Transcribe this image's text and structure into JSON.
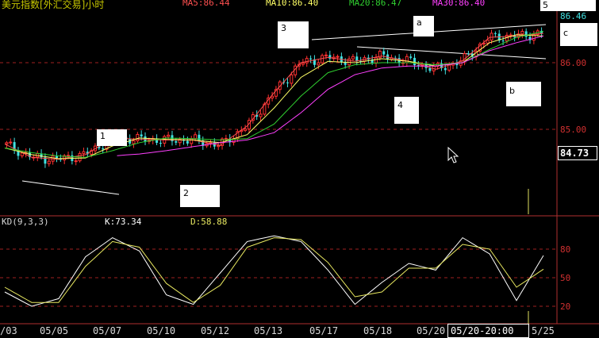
{
  "header": {
    "title": "美元指数[外汇交易]小时",
    "ma5": "MA5:86.44",
    "ma10": "MA10:86.40",
    "ma20": "MA20:86.47",
    "ma30": "MA30:86.40",
    "corner_number": "5"
  },
  "colors": {
    "title": "#c8c800",
    "ma5": "#ff5050",
    "ma10": "#ffff66",
    "ma20": "#30d030",
    "ma30": "#ff40ff",
    "up": "#ff3030",
    "down": "#40e0e0",
    "grid": "#a02020",
    "k": "#ffffff",
    "d": "#e8e860"
  },
  "price_axis": {
    "labels": [
      "86.46",
      "86.00",
      "85.00"
    ],
    "current": "84.73"
  },
  "annotations": {
    "box1": "1",
    "box2": "2",
    "box3": "3",
    "box4": "4",
    "boxa": "a",
    "boxb": "b",
    "boxc": "c"
  },
  "kd_panel": {
    "title": "KD(9,3,3)",
    "k": "K:73.34",
    "d": "D:58.88",
    "levels": [
      "80",
      "50",
      "20"
    ]
  },
  "time_axis": {
    "labels": [
      "/03",
      "05/05",
      "05/07",
      "05/10",
      "05/12",
      "05/13",
      "05/17",
      "05/18",
      "05/20"
    ],
    "cursor_label": "05/20-20:00",
    "end_label": "5/25"
  },
  "chart_data": [
    {
      "type": "line",
      "title": "美元指数[外汇交易]小时",
      "xlabel": "",
      "ylabel": "",
      "ylim": [
        84.3,
        86.6
      ],
      "grid": true,
      "x": [
        0,
        10,
        20,
        30,
        40,
        50,
        60,
        70,
        80,
        90,
        100,
        110,
        120,
        130,
        140,
        150,
        160,
        170,
        180,
        190,
        200
      ],
      "series": [
        {
          "name": "MA5",
          "values": [
            84.78,
            84.58,
            84.55,
            84.62,
            84.87,
            84.85,
            84.84,
            84.84,
            84.76,
            85.05,
            85.55,
            86.0,
            86.08,
            86.02,
            86.1,
            86.02,
            85.9,
            86.03,
            86.38,
            86.4,
            86.44
          ]
        },
        {
          "name": "MA10",
          "values": [
            84.72,
            84.62,
            84.56,
            84.57,
            84.75,
            84.87,
            84.85,
            84.84,
            84.8,
            84.92,
            85.32,
            85.78,
            86.02,
            86.0,
            86.06,
            86.02,
            85.95,
            86.0,
            86.3,
            86.42,
            86.4
          ]
        },
        {
          "name": "MA20",
          "values": [
            84.72,
            84.65,
            84.6,
            84.58,
            84.68,
            84.8,
            84.87,
            84.86,
            84.84,
            84.86,
            85.08,
            85.5,
            85.85,
            85.97,
            86.0,
            86.0,
            85.97,
            86.0,
            86.2,
            86.38,
            86.47
          ]
        },
        {
          "name": "MA30",
          "values": [
            null,
            null,
            null,
            null,
            84.6,
            84.63,
            84.68,
            84.74,
            84.8,
            84.84,
            84.95,
            85.25,
            85.6,
            85.82,
            85.92,
            85.95,
            85.95,
            86.0,
            86.18,
            86.3,
            86.4
          ]
        }
      ]
    },
    {
      "type": "line",
      "title": "KD(9,3,3)",
      "xlabel": "",
      "ylabel": "",
      "ylim": [
        0,
        100
      ],
      "grid": true,
      "x": [
        0,
        10,
        20,
        30,
        40,
        50,
        60,
        70,
        80,
        90,
        100,
        110,
        120,
        130,
        140,
        150,
        160,
        170,
        180,
        190,
        200
      ],
      "series": [
        {
          "name": "K",
          "values": [
            35,
            20,
            28,
            72,
            92,
            78,
            32,
            22,
            55,
            88,
            94,
            88,
            58,
            22,
            45,
            65,
            58,
            92,
            75,
            26,
            73.34
          ]
        },
        {
          "name": "D",
          "values": [
            40,
            24,
            24,
            62,
            88,
            82,
            44,
            24,
            42,
            82,
            92,
            90,
            66,
            30,
            35,
            60,
            60,
            85,
            80,
            40,
            58.88
          ]
        }
      ]
    }
  ]
}
